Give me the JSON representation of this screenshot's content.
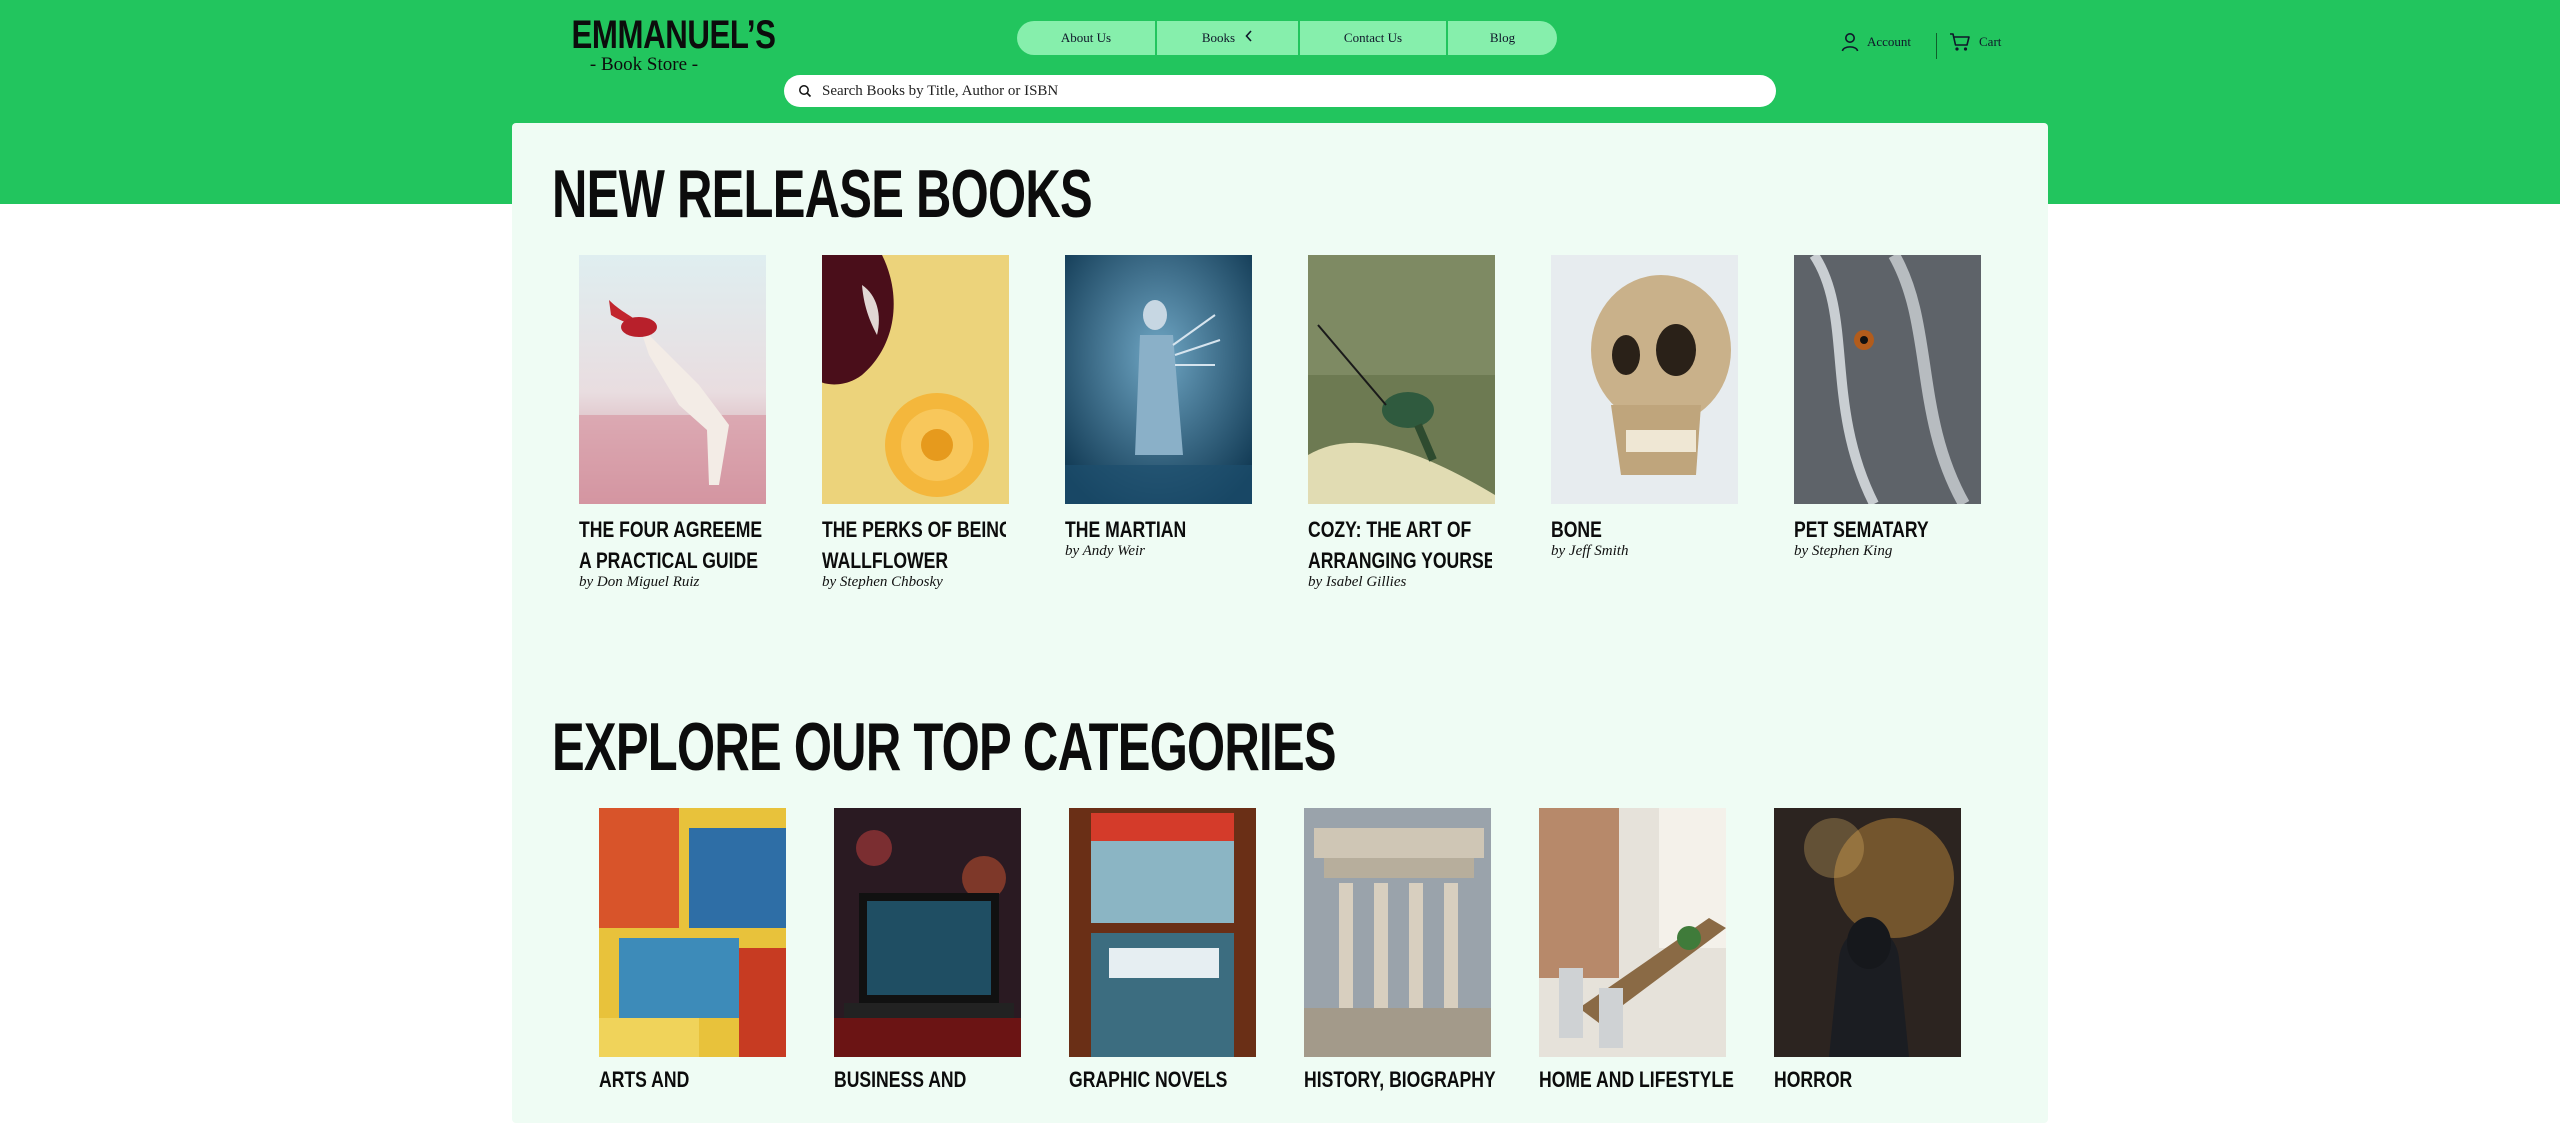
{
  "brand": {
    "title": "EMMANUEL’S",
    "subtitle": "- Book Store -"
  },
  "nav": {
    "items": [
      {
        "label": "About Us"
      },
      {
        "label": "Books"
      },
      {
        "label": "Contact Us"
      },
      {
        "label": "Blog"
      }
    ]
  },
  "search": {
    "placeholder": "Search Books by Title, Author or ISBN"
  },
  "account": {
    "label": "Account"
  },
  "cart": {
    "label": "Cart"
  },
  "colors": {
    "header_green": "#22c55e",
    "nav_pill": "#86efac",
    "panel_bg": "#effcf4"
  },
  "new_releases": {
    "heading": "NEW RELEASE BOOKS",
    "books": [
      {
        "title_line1": "THE FOUR AGREEMENTS:",
        "title_line2": "A PRACTICAL GUIDE TO...",
        "author": "by Don Miguel Ruiz",
        "cover": "woman-in-field"
      },
      {
        "title_line1": "THE PERKS OF BEING A",
        "title_line2": "WALLFLOWER",
        "author": "by Stephen Chbosky",
        "cover": "chestnut-and-flower"
      },
      {
        "title_line1": "THE MARTIAN",
        "title_line2": "",
        "author": "by Andy Weir",
        "cover": "figure-in-blue-smoke"
      },
      {
        "title_line1": "COZY: THE ART OF",
        "title_line2": "ARRANGING YOURSELF ...",
        "author": "by Isabel Gillies",
        "cover": "hummingbird"
      },
      {
        "title_line1": "BONE",
        "title_line2": "",
        "author": "by Jeff Smith",
        "cover": "skull"
      },
      {
        "title_line1": "PET SEMATARY",
        "title_line2": "",
        "author": "by Stephen King",
        "cover": "dog-face"
      }
    ]
  },
  "categories": {
    "heading": "EXPLORE OUR TOP CATEGORIES",
    "items": [
      {
        "label": "ARTS AND",
        "image": "abstract-painting"
      },
      {
        "label": "BUSINESS AND",
        "image": "laptop-dj"
      },
      {
        "label": "GRAPHIC NOVELS",
        "image": "comic-books"
      },
      {
        "label": "HISTORY, BIOGRAPHY",
        "image": "ancient-temple"
      },
      {
        "label": "HOME AND LIFESTYLE",
        "image": "dining-room"
      },
      {
        "label": "HORROR",
        "image": "hooded-figure"
      }
    ]
  }
}
